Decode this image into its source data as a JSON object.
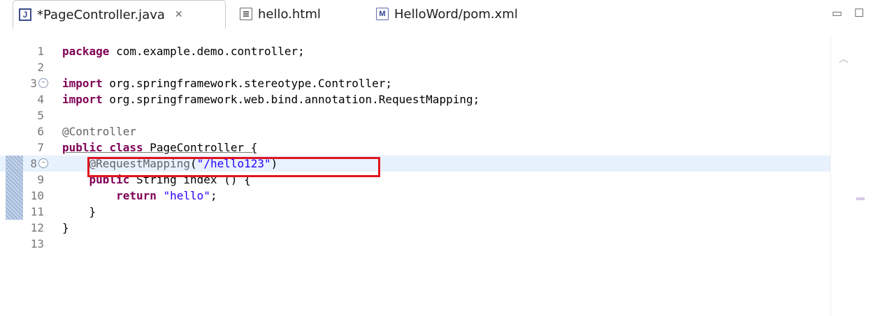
{
  "tabs": [
    {
      "label": "*PageController.java",
      "icon": "java-file-icon",
      "active": true,
      "close": "✕"
    },
    {
      "label": "hello.html",
      "icon": "html-file-icon",
      "active": false
    },
    {
      "label": "HelloWord/pom.xml",
      "icon": "maven-pom-icon",
      "active": false
    }
  ],
  "window_controls": {
    "minimize": "▭",
    "maximize": "☐"
  },
  "editor": {
    "lines": [
      {
        "num": "1",
        "text": "package com.example.demo.controller;"
      },
      {
        "num": "2",
        "text": ""
      },
      {
        "num": "3",
        "text": "import org.springframework.stereotype.Controller;",
        "fold": "⊖"
      },
      {
        "num": "4",
        "text": "import org.springframework.web.bind.annotation.RequestMapping;"
      },
      {
        "num": "5",
        "text": ""
      },
      {
        "num": "6",
        "text": "@Controller"
      },
      {
        "num": "7",
        "text": "public class PageController {"
      },
      {
        "num": "8",
        "text": "    @RequestMapping(\"/hello123\")",
        "fold": "⊖",
        "highlighted": true
      },
      {
        "num": "9",
        "text": "    public String index () {"
      },
      {
        "num": "10",
        "text": "        return \"hello\";"
      },
      {
        "num": "11",
        "text": "    }"
      },
      {
        "num": "12",
        "text": "}"
      },
      {
        "num": "13",
        "text": ""
      }
    ],
    "tokens": {
      "kw_package": "package",
      "pkg_name": " com.example.demo.controller;",
      "kw_import": "import",
      "import1": " org.springframework.stereotype.Controller;",
      "import2": " org.springframework.web.bind.annotation.RequestMapping;",
      "ann_controller": "@Controller",
      "kw_public": "public",
      "kw_class": "class",
      "class_name": "PageController",
      "brace_open": " {",
      "ann_request": "@RequestMapping",
      "paren_open": "(",
      "str_path": "\"/hello123\"",
      "paren_close": ")",
      "type_string": "String",
      "method_sig": " index () {",
      "kw_return": "return",
      "str_hello": "\"hello\"",
      "semicolon": ";",
      "close_inner": "    }",
      "close_outer": "}"
    }
  },
  "colors": {
    "keyword": "#7f0055",
    "string": "#2a00ff",
    "annotation": "#646464",
    "highlight_box": "#e0141e"
  }
}
